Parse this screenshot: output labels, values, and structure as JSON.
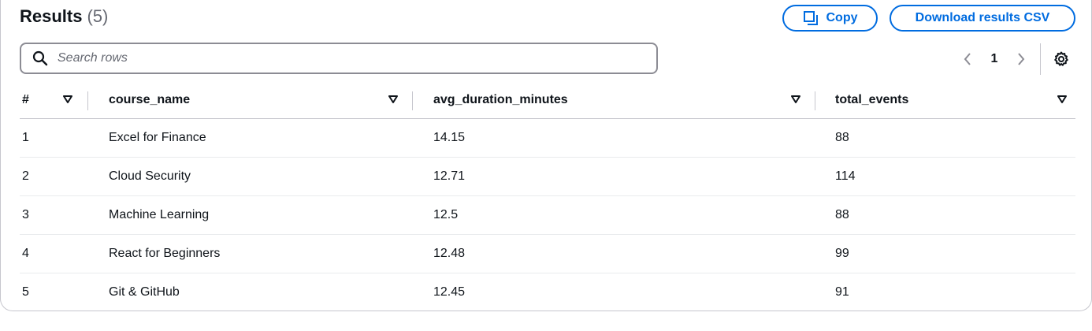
{
  "header": {
    "title": "Results",
    "count": "(5)",
    "copy_label": "Copy",
    "download_label": "Download results CSV"
  },
  "search": {
    "placeholder": "Search rows"
  },
  "pagination": {
    "current_page": "1"
  },
  "table": {
    "columns": [
      "#",
      "course_name",
      "avg_duration_minutes",
      "total_events"
    ],
    "rows": [
      [
        "1",
        "Excel for Finance",
        "14.15",
        "88"
      ],
      [
        "2",
        "Cloud Security",
        "12.71",
        "114"
      ],
      [
        "3",
        "Machine Learning",
        "12.5",
        "88"
      ],
      [
        "4",
        "React for Beginners",
        "12.48",
        "99"
      ],
      [
        "5",
        "Git & GitHub",
        "12.45",
        "91"
      ]
    ]
  },
  "colors": {
    "accent": "#006ce0",
    "text": "#0f141a",
    "muted": "#656871",
    "border": "#c6c6cd"
  },
  "icons": [
    "copy-icon",
    "search-icon",
    "chevron-left-icon",
    "chevron-right-icon",
    "settings-gear-icon",
    "sort-caret-icon"
  ]
}
